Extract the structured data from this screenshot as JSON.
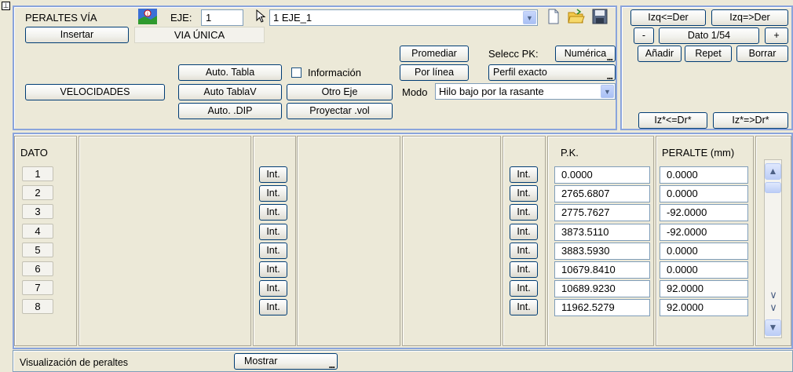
{
  "header": {
    "title": "PERALTES VÍA",
    "eje_label": "EJE:",
    "eje_value": "1",
    "eje_combo_value": "1 EJE_1",
    "via_label": "VIA ÚNICA",
    "informacion_label": "Información",
    "selecc_pk_label": "Selecc PK:",
    "modo_label": "Modo",
    "modo_value": "Hilo bajo por la rasante"
  },
  "buttons": {
    "insertar": "Insertar",
    "velocidades": "VELOCIDADES",
    "auto_tabla": "Auto. Tabla",
    "auto_tablav": "Auto TablaV",
    "auto_dip": "Auto. .DIP",
    "otro_eje": "Otro Eje",
    "proyectar_vol": "Proyectar .vol",
    "promediar": "Promediar",
    "por_linea": "Por línea",
    "numerica": "Numérica",
    "perfil_exacto": "Perfil exacto",
    "izq_der_1": "Izq<=Der",
    "izq_der_2": "Izq=>Der",
    "minus": "-",
    "dato": "Dato 1/54",
    "plus": "+",
    "anadir": "Añadir",
    "repet": "Repet",
    "borrar": "Borrar",
    "iz_dr_1": "Iz*<=Dr*",
    "iz_dr_2": "Iz*=>Dr*"
  },
  "table": {
    "dato_header": "DATO",
    "pk_header": "P.K.",
    "peralte_header": "PERALTE (mm)",
    "int_label": "Int.",
    "rows": [
      {
        "n": "1",
        "pk": "0.0000",
        "peralte": "0.0000"
      },
      {
        "n": "2",
        "pk": "2765.6807",
        "peralte": "0.0000"
      },
      {
        "n": "3",
        "pk": "2775.7627",
        "peralte": "-92.0000"
      },
      {
        "n": "4",
        "pk": "3873.5110",
        "peralte": "-92.0000"
      },
      {
        "n": "5",
        "pk": "3883.5930",
        "peralte": "0.0000"
      },
      {
        "n": "6",
        "pk": "10679.8410",
        "peralte": "0.0000"
      },
      {
        "n": "7",
        "pk": "10689.9230",
        "peralte": "92.0000"
      },
      {
        "n": "8",
        "pk": "11962.5279",
        "peralte": "92.0000"
      }
    ]
  },
  "footer": {
    "label": "Visualización de peraltes",
    "mostrar": "Mostrar"
  },
  "icons": {
    "pin": "pin-icon",
    "eje": "axis-graphic-icon",
    "cursor": "cursor-arrow-icon",
    "new": "new-file-icon",
    "open": "open-folder-icon",
    "save": "save-disk-icon"
  }
}
